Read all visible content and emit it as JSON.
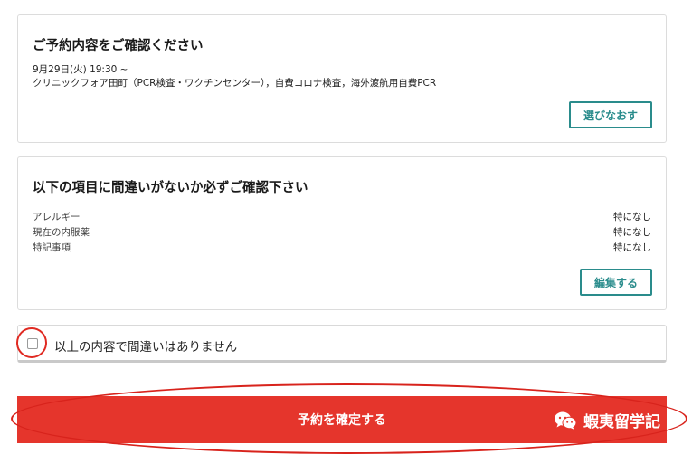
{
  "reservation": {
    "title": "ご予約内容をご確認ください",
    "datetime": "9月29日(火) 19:30 ~",
    "clinic": "クリニックフォア田町（PCR検査・ワクチンセンター），自費コロナ検査，海外渡航用自費PCR",
    "rechoose_label": "選びなおす"
  },
  "confirm_items": {
    "title": "以下の項目に間違いがないか必ずご確認下さい",
    "rows": [
      {
        "label": "アレルギー",
        "value": "特になし"
      },
      {
        "label": "現在の内服薬",
        "value": "特になし"
      },
      {
        "label": "特記事項",
        "value": "特になし"
      }
    ],
    "edit_label": "編集する"
  },
  "agreement": {
    "label": "以上の内容で間違いはありません",
    "checked": false
  },
  "submit": {
    "label": "予約を確定する"
  },
  "watermark": {
    "icon": "wechat-icon",
    "text": "蝦夷留学記"
  },
  "colors": {
    "accent_teal": "#2a8c8c",
    "submit_red": "#e5352c",
    "annotation_red": "#e02a22"
  }
}
